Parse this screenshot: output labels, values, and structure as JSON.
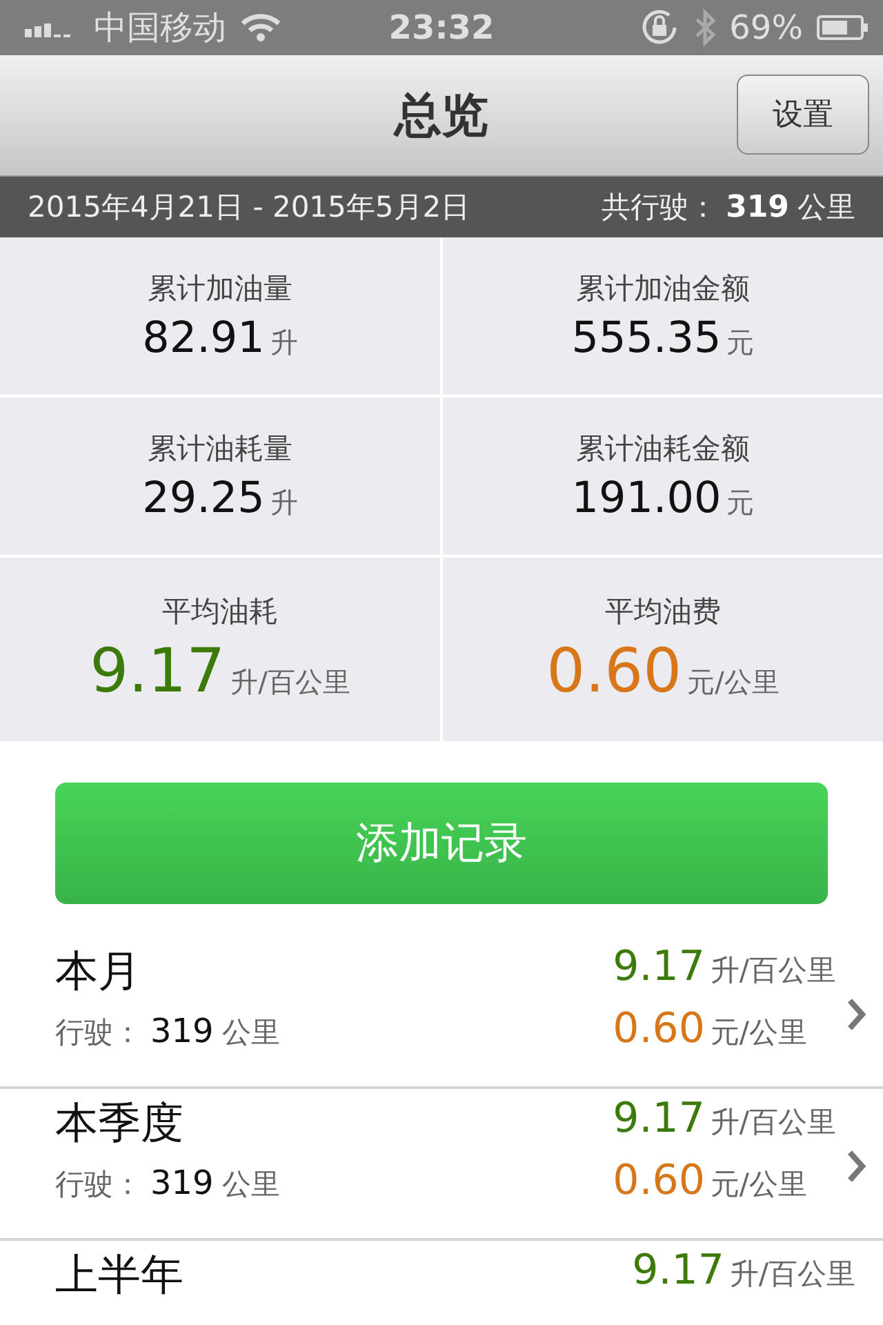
{
  "status_bar": {
    "carrier": "中国移动",
    "time": "23:32",
    "battery": "69%"
  },
  "nav": {
    "title": "总览",
    "settings_button": "设置"
  },
  "summary": {
    "date_range": "2015年4月21日 - 2015年5月2日",
    "distance_label": "共行驶：",
    "distance_value": "319",
    "distance_unit": "公里"
  },
  "stats": [
    {
      "kind": "total",
      "label": "累计加油量",
      "value": "82.91",
      "unit": "升"
    },
    {
      "kind": "total",
      "label": "累计加油金额",
      "value": "555.35",
      "unit": "元"
    },
    {
      "kind": "total",
      "label": "累计油耗量",
      "value": "29.25",
      "unit": "升"
    },
    {
      "kind": "total",
      "label": "累计油耗金额",
      "value": "191.00",
      "unit": "元"
    },
    {
      "kind": "average",
      "label": "平均油耗",
      "value": "9.17",
      "unit": "升/百公里",
      "color": "#3d7a0c"
    },
    {
      "kind": "average",
      "label": "平均油费",
      "value": "0.60",
      "unit": "元/公里",
      "color": "#d8761a"
    }
  ],
  "add_button": "添加记录",
  "periods": [
    {
      "name": "本月",
      "distance_label": "行驶：",
      "distance_value": "319",
      "distance_unit": "公里",
      "consumption": "9.17",
      "consumption_unit": "升/百公里",
      "cost": "0.60",
      "cost_unit": "元/公里"
    },
    {
      "name": "本季度",
      "distance_label": "行驶：",
      "distance_value": "319",
      "distance_unit": "公里",
      "consumption": "9.17",
      "consumption_unit": "升/百公里",
      "cost": "0.60",
      "cost_unit": "元/公里"
    },
    {
      "name": "上半年",
      "consumption": "9.17",
      "consumption_unit": "升/百公里"
    }
  ]
}
